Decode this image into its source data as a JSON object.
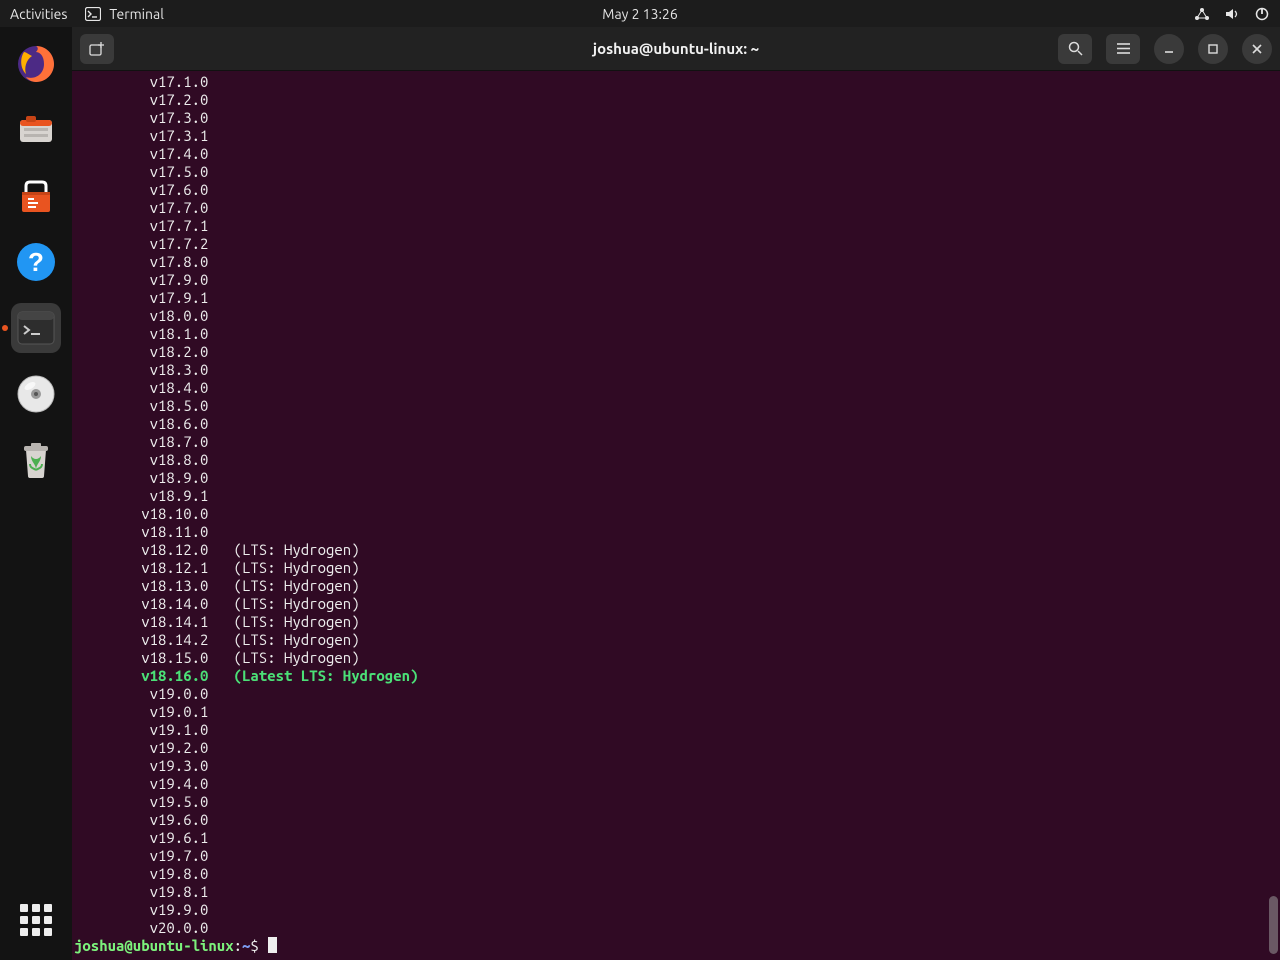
{
  "topbar": {
    "activities": "Activities",
    "app_label": "Terminal",
    "clock": "May 2  13:26"
  },
  "window": {
    "title": "joshua@ubuntu-linux: ~"
  },
  "terminal": {
    "lines": [
      {
        "version": "v17.1.0",
        "note": ""
      },
      {
        "version": "v17.2.0",
        "note": ""
      },
      {
        "version": "v17.3.0",
        "note": ""
      },
      {
        "version": "v17.3.1",
        "note": ""
      },
      {
        "version": "v17.4.0",
        "note": ""
      },
      {
        "version": "v17.5.0",
        "note": ""
      },
      {
        "version": "v17.6.0",
        "note": ""
      },
      {
        "version": "v17.7.0",
        "note": ""
      },
      {
        "version": "v17.7.1",
        "note": ""
      },
      {
        "version": "v17.7.2",
        "note": ""
      },
      {
        "version": "v17.8.0",
        "note": ""
      },
      {
        "version": "v17.9.0",
        "note": ""
      },
      {
        "version": "v17.9.1",
        "note": ""
      },
      {
        "version": "v18.0.0",
        "note": ""
      },
      {
        "version": "v18.1.0",
        "note": ""
      },
      {
        "version": "v18.2.0",
        "note": ""
      },
      {
        "version": "v18.3.0",
        "note": ""
      },
      {
        "version": "v18.4.0",
        "note": ""
      },
      {
        "version": "v18.5.0",
        "note": ""
      },
      {
        "version": "v18.6.0",
        "note": ""
      },
      {
        "version": "v18.7.0",
        "note": ""
      },
      {
        "version": "v18.8.0",
        "note": ""
      },
      {
        "version": "v18.9.0",
        "note": ""
      },
      {
        "version": "v18.9.1",
        "note": ""
      },
      {
        "version": "v18.10.0",
        "note": ""
      },
      {
        "version": "v18.11.0",
        "note": ""
      },
      {
        "version": "v18.12.0",
        "note": "(LTS: Hydrogen)"
      },
      {
        "version": "v18.12.1",
        "note": "(LTS: Hydrogen)"
      },
      {
        "version": "v18.13.0",
        "note": "(LTS: Hydrogen)"
      },
      {
        "version": "v18.14.0",
        "note": "(LTS: Hydrogen)"
      },
      {
        "version": "v18.14.1",
        "note": "(LTS: Hydrogen)"
      },
      {
        "version": "v18.14.2",
        "note": "(LTS: Hydrogen)"
      },
      {
        "version": "v18.15.0",
        "note": "(LTS: Hydrogen)"
      },
      {
        "version": "v18.16.0",
        "note": "(Latest LTS: Hydrogen)",
        "green": true
      },
      {
        "version": "v19.0.0",
        "note": ""
      },
      {
        "version": "v19.0.1",
        "note": ""
      },
      {
        "version": "v19.1.0",
        "note": ""
      },
      {
        "version": "v19.2.0",
        "note": ""
      },
      {
        "version": "v19.3.0",
        "note": ""
      },
      {
        "version": "v19.4.0",
        "note": ""
      },
      {
        "version": "v19.5.0",
        "note": ""
      },
      {
        "version": "v19.6.0",
        "note": ""
      },
      {
        "version": "v19.6.1",
        "note": ""
      },
      {
        "version": "v19.7.0",
        "note": ""
      },
      {
        "version": "v19.8.0",
        "note": ""
      },
      {
        "version": "v19.8.1",
        "note": ""
      },
      {
        "version": "v19.9.0",
        "note": ""
      },
      {
        "version": "v20.0.0",
        "note": ""
      }
    ],
    "prompt": {
      "user": "joshua@ubuntu-linux",
      "sep1": ":",
      "path": "~",
      "sep2": "$ "
    }
  },
  "dock": {
    "items": [
      "firefox",
      "files",
      "software",
      "help",
      "terminal",
      "disc",
      "trash"
    ]
  }
}
